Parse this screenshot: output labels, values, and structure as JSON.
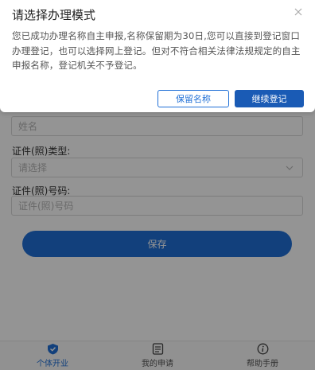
{
  "form": {
    "name_placeholder": "姓名",
    "id_type_label": "证件(照)类型:",
    "id_type_placeholder": "请选择",
    "id_number_label": "证件(照)号码:",
    "id_number_placeholder": "证件(照)号码",
    "save_label": "保存"
  },
  "tabbar": {
    "items": [
      {
        "label": "个体开业",
        "icon": "shield-icon",
        "active": true
      },
      {
        "label": "我的申请",
        "icon": "document-list-icon",
        "active": false
      },
      {
        "label": "帮助手册",
        "icon": "info-icon",
        "active": false
      }
    ]
  },
  "modal": {
    "title": "请选择办理模式",
    "body": "您已成功办理名称自主申报,名称保留期为30日,您可以直接到登记窗口办理登记，也可以选择网上登记。但对不符合相关法律法规规定的自主申报名称，登记机关不予登记。",
    "keep_name_label": "保留名称",
    "continue_label": "继续登记"
  },
  "colors": {
    "primary": "#1f6fd6",
    "overlay": "rgba(0,0,0,0.42)"
  }
}
